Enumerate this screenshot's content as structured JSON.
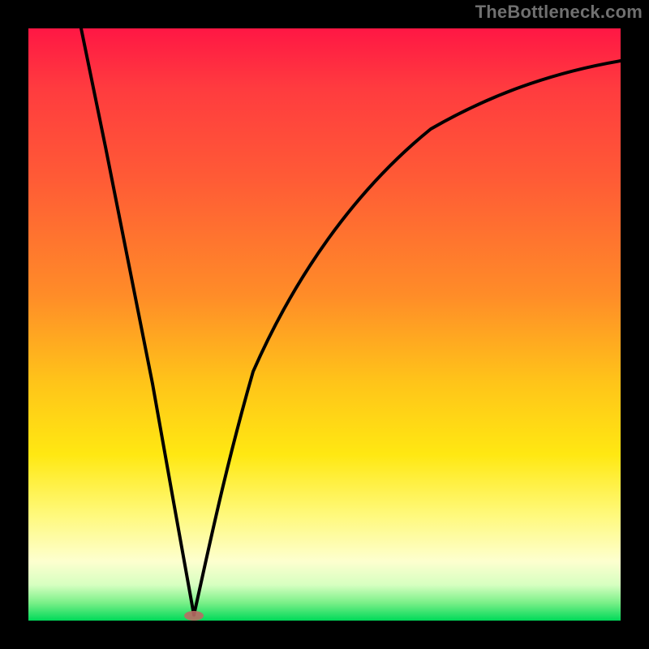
{
  "watermark": "TheBottleneck.com",
  "colors": {
    "frame_bg": "#000000",
    "curve_stroke": "#000000",
    "marker_fill": "#b96a64"
  },
  "chart_data": {
    "type": "line",
    "title": "",
    "xlabel": "",
    "ylabel": "",
    "xlim": [
      0,
      1
    ],
    "ylim": [
      0,
      1
    ],
    "cusp": {
      "x": 0.28,
      "y": 0.0
    },
    "segments": [
      {
        "name": "left-branch",
        "points": [
          {
            "x": 0.09,
            "y": 1.0
          },
          {
            "x": 0.13,
            "y": 0.8
          },
          {
            "x": 0.17,
            "y": 0.6
          },
          {
            "x": 0.21,
            "y": 0.4
          },
          {
            "x": 0.245,
            "y": 0.2
          },
          {
            "x": 0.28,
            "y": 0.01
          }
        ]
      },
      {
        "name": "right-branch",
        "points": [
          {
            "x": 0.28,
            "y": 0.01
          },
          {
            "x": 0.3,
            "y": 0.1
          },
          {
            "x": 0.33,
            "y": 0.25
          },
          {
            "x": 0.38,
            "y": 0.42
          },
          {
            "x": 0.45,
            "y": 0.58
          },
          {
            "x": 0.55,
            "y": 0.725
          },
          {
            "x": 0.68,
            "y": 0.83
          },
          {
            "x": 0.82,
            "y": 0.895
          },
          {
            "x": 1.0,
            "y": 0.945
          }
        ]
      }
    ],
    "gradient_stops": [
      {
        "pos": 0.0,
        "color": "#ff1744"
      },
      {
        "pos": 0.45,
        "color": "#ff8c28"
      },
      {
        "pos": 0.72,
        "color": "#ffe812"
      },
      {
        "pos": 0.94,
        "color": "#d6ffc0"
      },
      {
        "pos": 1.0,
        "color": "#00d959"
      }
    ]
  }
}
